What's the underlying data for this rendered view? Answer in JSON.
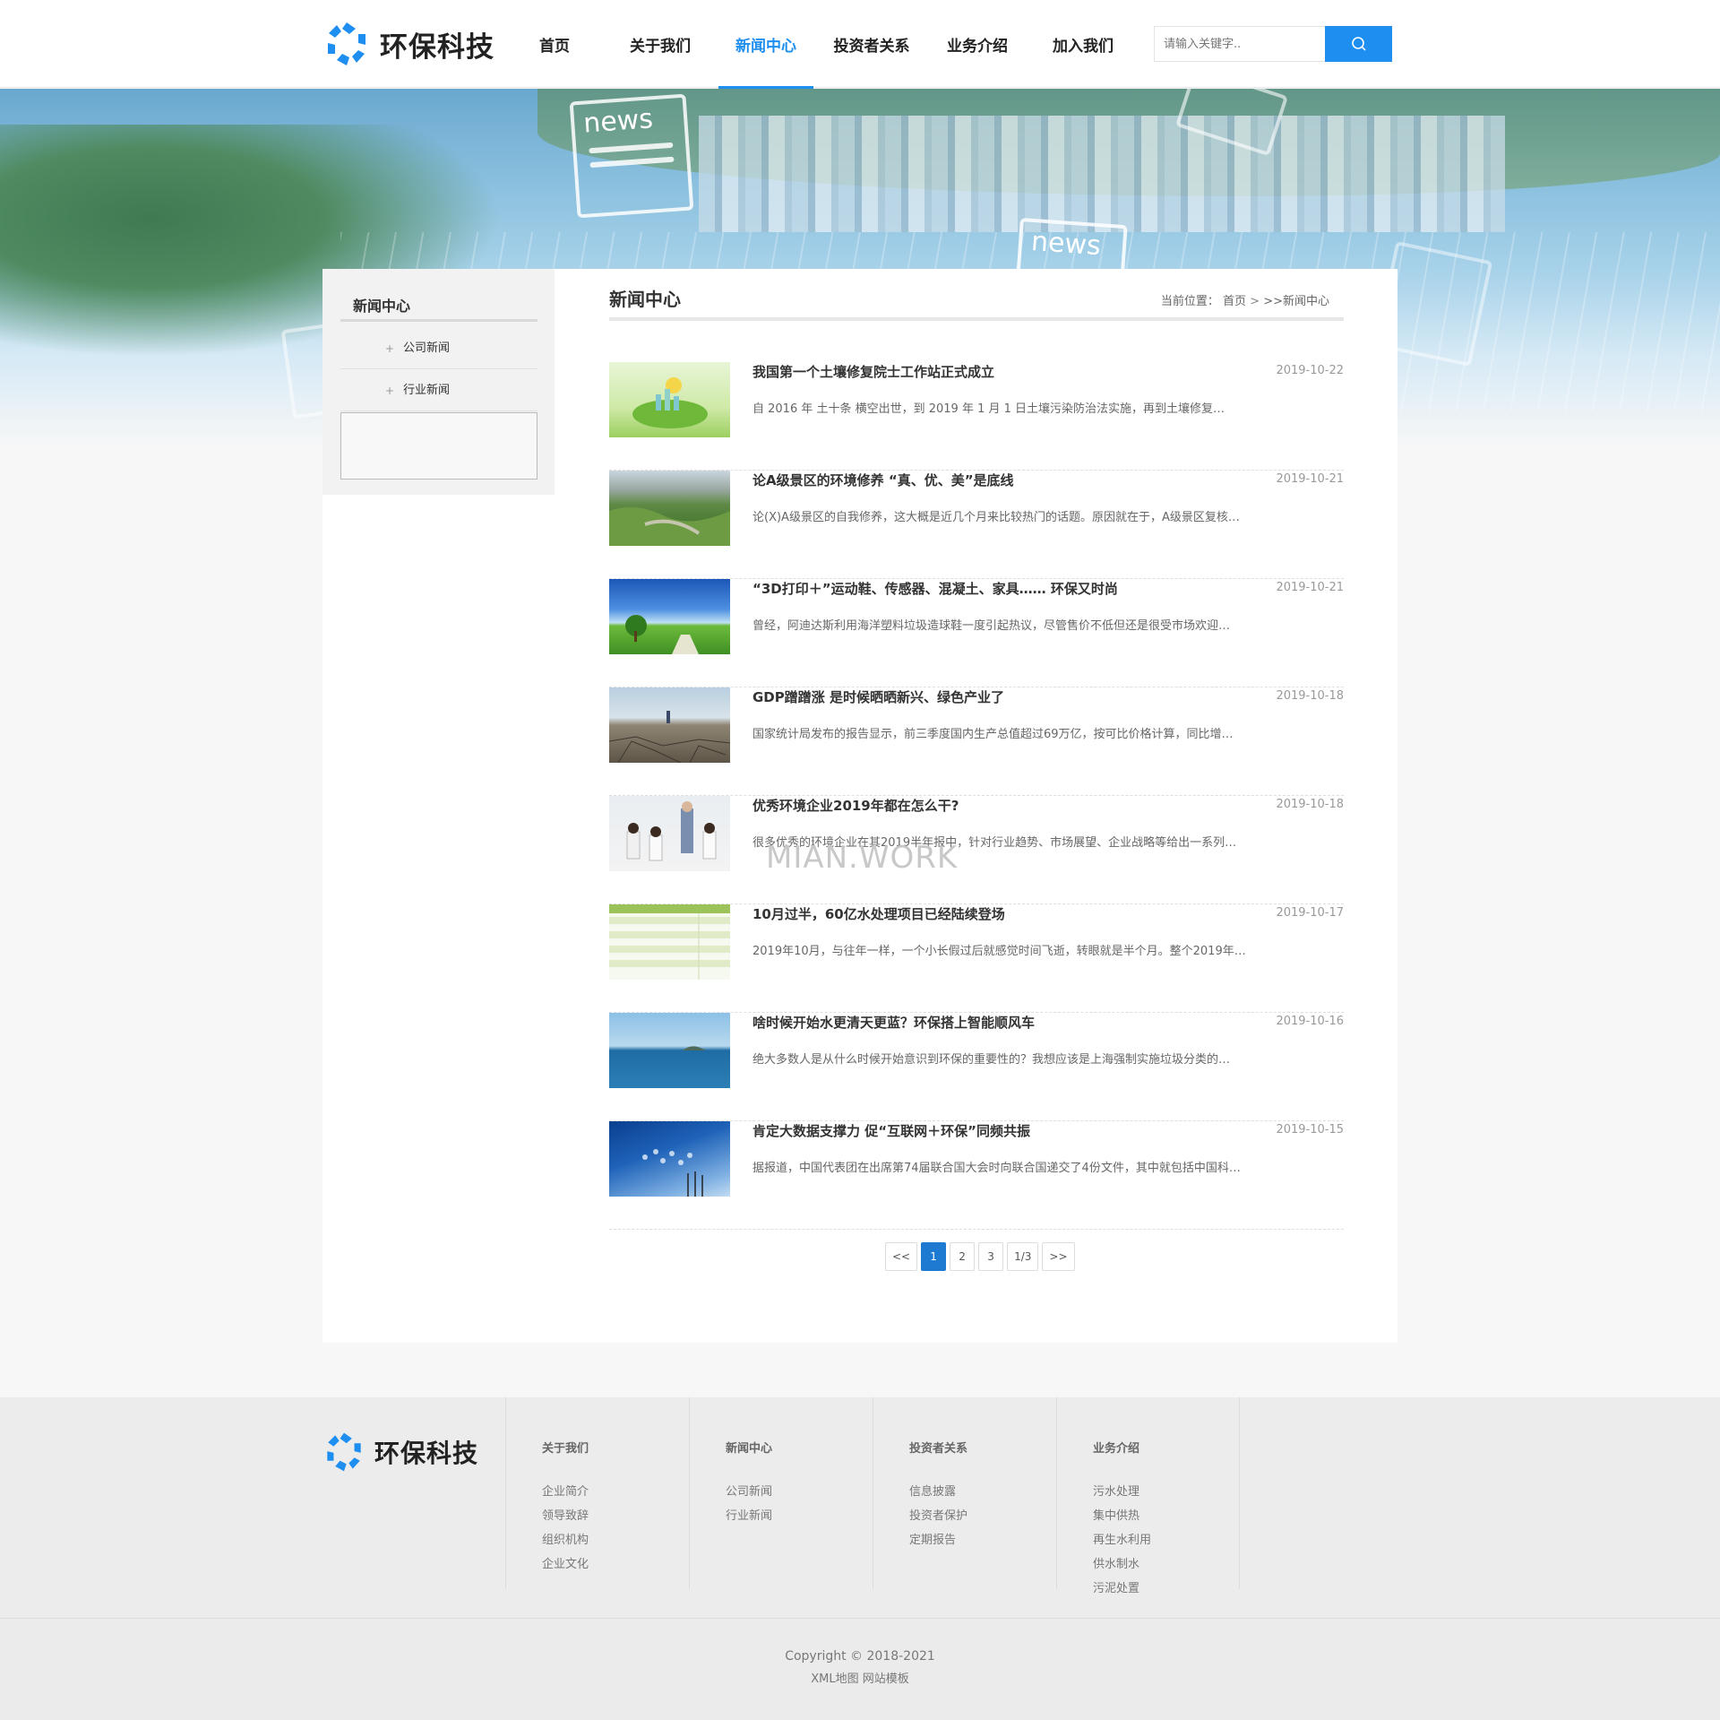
{
  "site": {
    "logo_text": "环保科技"
  },
  "nav": [
    {
      "label": "首页"
    },
    {
      "label": "关于我们"
    },
    {
      "label": "新闻中心",
      "active": true
    },
    {
      "label": "投资者关系"
    },
    {
      "label": "业务介绍"
    },
    {
      "label": "加入我们"
    }
  ],
  "search": {
    "placeholder": "请输入关键字..",
    "icon": "search-icon"
  },
  "banner": {
    "card_word": "news"
  },
  "sidebar": {
    "title": "新闻中心",
    "items": [
      {
        "label": "公司新闻"
      },
      {
        "label": "行业新闻"
      }
    ]
  },
  "main": {
    "title": "新闻中心",
    "breadcrumb_prefix": "当前位置：",
    "breadcrumb_home": "首页",
    "breadcrumb_sep": " > ",
    "breadcrumb_current": ">>新闻中心"
  },
  "news": [
    {
      "title": "我国第一个土壤修复院士工作站正式成立",
      "date": "2019-10-22",
      "summary": "自 2016 年 土十条 横空出世，到 2019 年 1 月 1 日土壤污染防治法实施，再到土壤修复…"
    },
    {
      "title": "论A级景区的环境修养 “真、优、美”是底线",
      "date": "2019-10-21",
      "summary": "论(X)A级景区的自我修养，这大概是近几个月来比较热门的话题。原因就在于，A级景区复核…"
    },
    {
      "title": "“3D打印＋”运动鞋、传感器、混凝土、家具…… 环保又时尚",
      "date": "2019-10-21",
      "summary": "曾经，阿迪达斯利用海洋塑料垃圾造球鞋一度引起热议，尽管售价不低但还是很受市场欢迎…"
    },
    {
      "title": "GDP蹭蹭涨 是时候晒晒新兴、绿色产业了",
      "date": "2019-10-18",
      "summary": "国家统计局发布的报告显示，前三季度国内生产总值超过69万亿，按可比价格计算，同比增…"
    },
    {
      "title": "优秀环境企业2019年都在怎么干?",
      "date": "2019-10-18",
      "summary": "很多优秀的环境企业在其2019半年报中，针对行业趋势、市场展望、企业战略等给出一系列…"
    },
    {
      "title": "10月过半，60亿水处理项目已经陆续登场",
      "date": "2019-10-17",
      "summary": "2019年10月，与往年一样，一个小长假过后就感觉时间飞逝，转眼就是半个月。整个2019年…"
    },
    {
      "title": "啥时候开始水更清天更蓝？环保搭上智能顺风车",
      "date": "2019-10-16",
      "summary": "绝大多数人是从什么时候开始意识到环保的重要性的？我想应该是上海强制实施垃圾分类的…"
    },
    {
      "title": "肯定大数据支撑力 促“互联网＋环保”同频共振",
      "date": "2019-10-15",
      "summary": "据报道，中国代表团在出席第74届联合国大会时向联合国递交了4份文件，其中就包括中国科…"
    }
  ],
  "watermark": "MIAN.WORK",
  "pager": [
    {
      "label": "<<"
    },
    {
      "label": "1",
      "active": true
    },
    {
      "label": "2"
    },
    {
      "label": "3"
    },
    {
      "label": "1/3"
    },
    {
      "label": ">>"
    }
  ],
  "footer": {
    "logo_text": "环保科技",
    "columns": [
      {
        "title": "关于我们",
        "links": [
          "企业简介",
          "领导致辞",
          "组织机构",
          "企业文化"
        ]
      },
      {
        "title": "新闻中心",
        "links": [
          "公司新闻",
          "行业新闻"
        ]
      },
      {
        "title": "投资者关系",
        "links": [
          "信息披露",
          "投资者保护",
          "定期报告"
        ]
      },
      {
        "title": "业务介绍",
        "links": [
          "污水处理",
          "集中供热",
          "再生水利用",
          "供水制水",
          "污泥处置"
        ]
      }
    ],
    "copyright": "Copyright © 2018-2021",
    "bottom_links": [
      "XML地图",
      "网站模板"
    ]
  },
  "colors": {
    "accent": "#1e8ef0",
    "pager_active": "#1e7ad0"
  }
}
